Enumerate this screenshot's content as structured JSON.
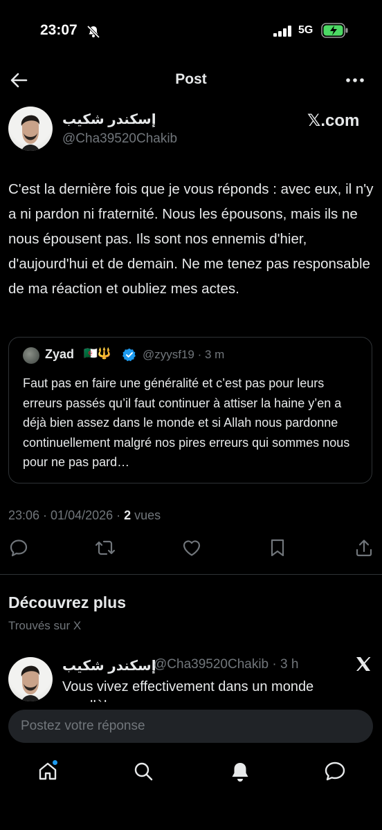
{
  "status_bar": {
    "time": "23:07",
    "network": "5G"
  },
  "header": {
    "title": "Post"
  },
  "post": {
    "author_name": "إسكندر شكيب",
    "author_handle": "@Cha39520Chakib",
    "source_label": "𝕏.com",
    "text": "C'est la dernière fois que je vous réponds : avec eux, il n'y a ni pardon ni fraternité. Nous les épousons, mais ils ne nous épousent pas. Ils sont nos ennemis d'hier, d'aujourd'hui et de demain. Ne me tenez pas responsable de ma réaction et oubliez mes actes.",
    "timestamp": "23:06 · 01/04/2026 · ",
    "views_count": "2",
    "views_label": " vues"
  },
  "quoted_post": {
    "author_name": "Zyad",
    "flags": "🇩🇿🔱",
    "handle_time": "@zyysf19 · 3 m",
    "text": "Faut pas en faire une généralité et c’est pas pour leurs erreurs passés qu’il faut continuer à attiser la haine y’en a déjà bien assez dans le monde et si Allah nous pardonne continuellement malgré nos pires erreurs qui sommes nous pour ne pas pard…"
  },
  "actions": [
    "reply-icon",
    "repost-icon",
    "like-icon",
    "bookmark-icon",
    "share-icon"
  ],
  "discover": {
    "title": "Découvrez plus",
    "subtitle": "Trouvés sur X"
  },
  "related_post": {
    "author_name": "إسكندر شكيب",
    "handle_time": "@Cha39520Chakib · 3 h",
    "text": "Vous vivez effectivement dans un monde parallèle"
  },
  "reply_box": {
    "placeholder": "Postez votre réponse"
  },
  "bottom_nav": [
    "home-icon",
    "search-icon",
    "notifications-icon",
    "messages-icon"
  ],
  "colors": {
    "background": "#000000",
    "text": "#e7e9ea",
    "muted": "#71767b",
    "accent": "#1d9bf0",
    "battery": "#4cd964"
  }
}
